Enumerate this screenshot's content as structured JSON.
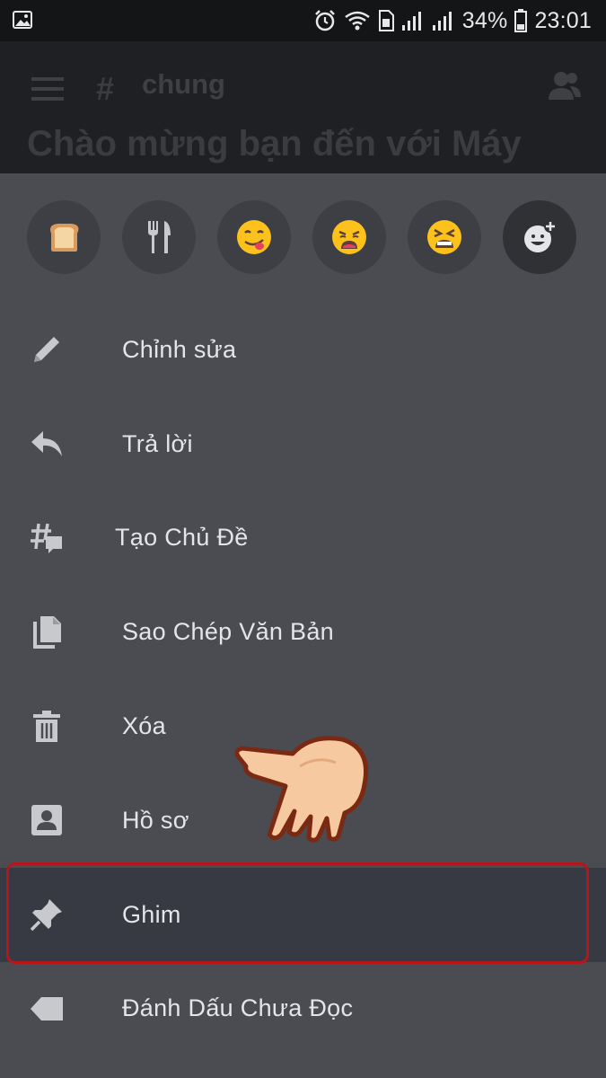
{
  "status_bar": {
    "battery": "34%",
    "time": "23:01",
    "icons": [
      "image-icon",
      "alarm-icon",
      "wifi-icon",
      "sim-icon",
      "signal-icon",
      "signal-icon",
      "battery-icon"
    ]
  },
  "header": {
    "channel_prefix": "#",
    "channel_name": "chung",
    "welcome_text": "Chào mừng bạn đến với Máy"
  },
  "reactions": [
    {
      "icon": "bread-emoji"
    },
    {
      "icon": "fork-knife-emoji"
    },
    {
      "icon": "yum-face-emoji"
    },
    {
      "icon": "weary-face-emoji"
    },
    {
      "icon": "tired-face-emoji"
    },
    {
      "icon": "add-reaction-icon"
    }
  ],
  "menu": {
    "items": [
      {
        "label": "Chỉnh sửa",
        "icon": "pencil-icon"
      },
      {
        "label": "Trả lời",
        "icon": "reply-icon"
      },
      {
        "label": "Tạo Chủ Đề",
        "icon": "thread-icon"
      },
      {
        "label": "Sao Chép Văn Bản",
        "icon": "copy-icon"
      },
      {
        "label": "Xóa",
        "icon": "trash-icon"
      },
      {
        "label": "Hồ sơ",
        "icon": "profile-icon"
      },
      {
        "label": "Ghim",
        "icon": "pin-icon"
      },
      {
        "label": "Đánh Dấu Chưa Đọc",
        "icon": "mark-unread-icon"
      }
    ],
    "highlighted_index": 6
  },
  "colors": {
    "sheet_background": "#4a4c52",
    "highlight_border": "#b5161b",
    "text": "#e4e5e8",
    "icon": "#c8c9cc"
  }
}
